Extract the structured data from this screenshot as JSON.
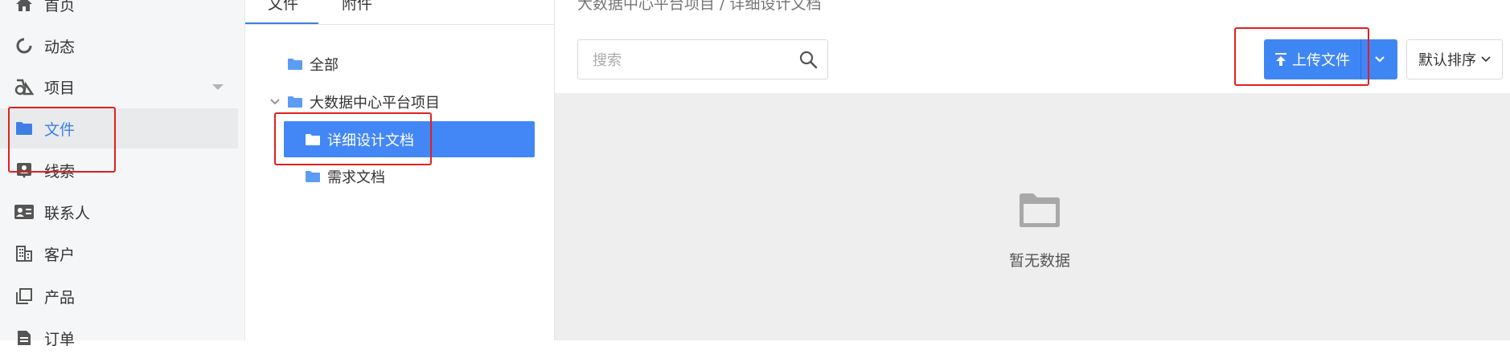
{
  "sidebar": {
    "items": [
      {
        "label": "首页",
        "icon": "home-icon"
      },
      {
        "label": "动态",
        "icon": "activity-icon"
      },
      {
        "label": "项目",
        "icon": "project-icon"
      },
      {
        "label": "文件",
        "icon": "folder-icon"
      },
      {
        "label": "线索",
        "icon": "lead-icon"
      },
      {
        "label": "联系人",
        "icon": "contact-card-icon"
      },
      {
        "label": "客户",
        "icon": "building-icon"
      },
      {
        "label": "产品",
        "icon": "product-icon"
      },
      {
        "label": "订单",
        "icon": "order-icon"
      }
    ],
    "active_label": "文件"
  },
  "tree_panel": {
    "tabs": [
      "文件",
      "附件"
    ],
    "nodes": [
      {
        "label": "全部"
      },
      {
        "label": "大数据中心平台项目"
      },
      {
        "label": "详细设计文档"
      },
      {
        "label": "需求文档"
      }
    ],
    "selected": "详细设计文档"
  },
  "breadcrumb": "大数据中心平台项目 / 详细设计文档",
  "toolbar": {
    "search_placeholder": "搜索",
    "upload_label": "上传文件",
    "sort_label": "默认排序"
  },
  "empty_state": {
    "text": "暂无数据"
  },
  "colors": {
    "accent": "#3f86f5",
    "highlight": "#e02020"
  }
}
